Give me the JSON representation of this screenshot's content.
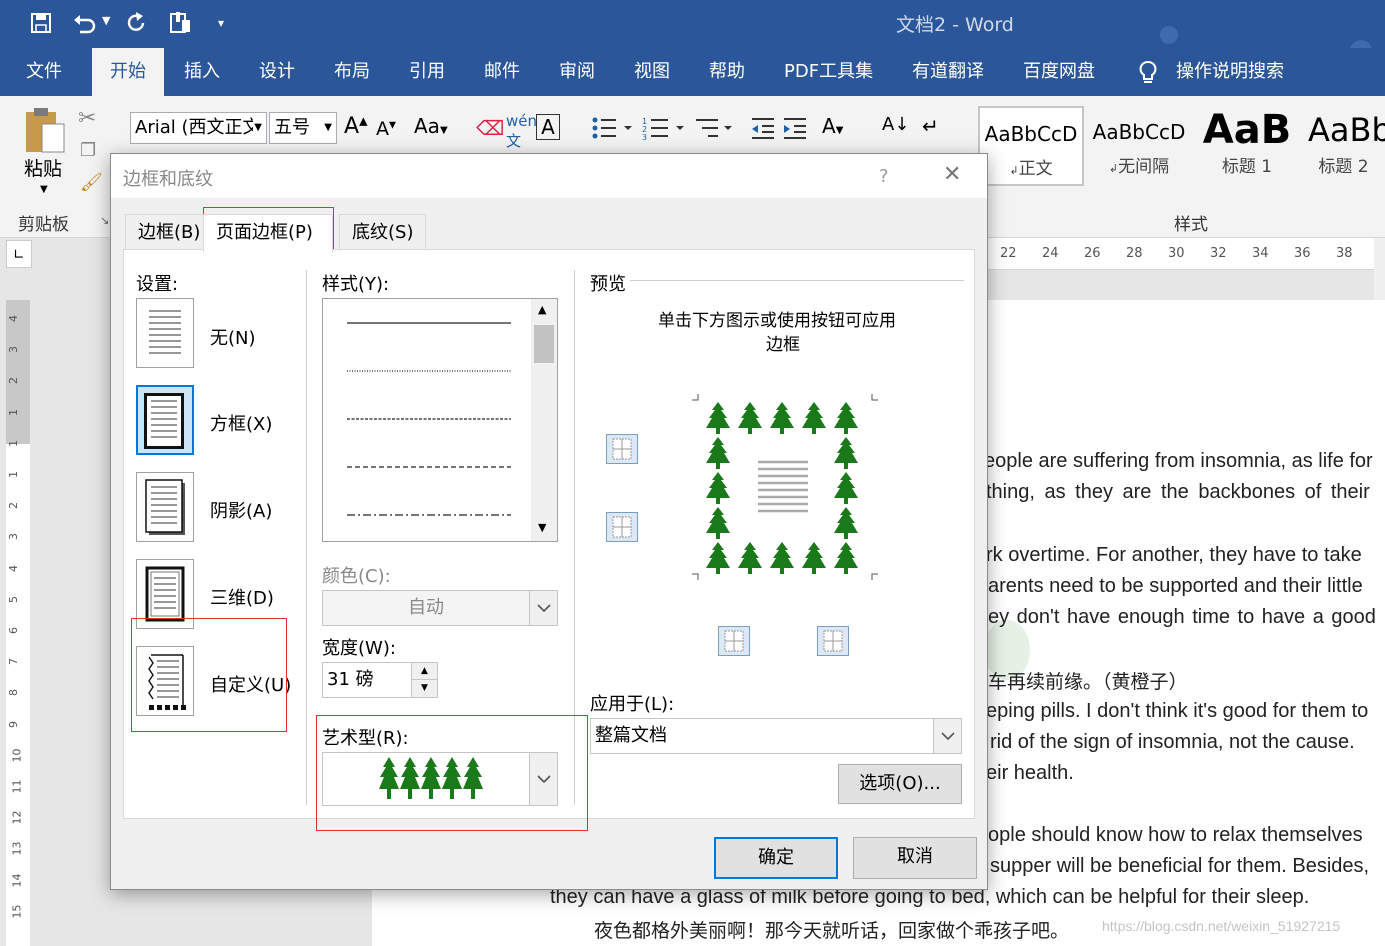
{
  "window": {
    "title": "文档2  -  Word"
  },
  "menu": {
    "items": [
      "文件",
      "开始",
      "插入",
      "设计",
      "布局",
      "引用",
      "邮件",
      "审阅",
      "视图",
      "帮助",
      "PDF工具集",
      "有道翻译",
      "百度网盘"
    ],
    "active": "开始",
    "search": "操作说明搜索"
  },
  "ribbon": {
    "paste": "粘贴",
    "clipboard_group": "剪贴板",
    "font_name": "Arial (西文正文",
    "font_size": "五号",
    "styles_group": "样式",
    "styles": [
      {
        "sample": "AaBbCcD",
        "name": "正文"
      },
      {
        "sample": "AaBbCcD",
        "name": "无间隔"
      },
      {
        "sample": "AaB",
        "name": "标题 1"
      },
      {
        "sample": "AaBb",
        "name": "标题 2"
      }
    ]
  },
  "ruler": {
    "top_ticks": [
      "22",
      "24",
      "26",
      "28",
      "30",
      "32",
      "34",
      "36",
      "38"
    ],
    "left_ticks": [
      "4",
      "3",
      "2",
      "1",
      "1",
      "1",
      "2",
      "3",
      "4",
      "5",
      "6",
      "7",
      "8",
      "9",
      "10",
      "11",
      "12",
      "13",
      "14",
      "15"
    ]
  },
  "document": {
    "lines": [
      "eople are suffering from insomnia, as life for",
      "thing, as they are the backbones of their",
      "rk overtime. For another, they have to take",
      "arents need to be supported and their little",
      "ey don't have enough time to have a good",
      "车再续前缘。（黄橙子）",
      "eping pills. I don't think it's good for them to",
      "rid of the sign of insomnia, not the cause.",
      "eir health.",
      "ople should know how to relax themselves",
      "supper will be beneficial for them. Besides,",
      "they can have a glass of milk before going to bed, which can be helpful for their sleep.",
      "夜色都格外美丽啊！那今天就听话，回家做个乖孩子吧。"
    ],
    "watermark": "https://blog.csdn.net/weixin_51927215"
  },
  "dialog": {
    "title": "边框和底纹",
    "help": "?",
    "tabs": [
      "边框(B)",
      "页面边框(P)",
      "底纹(S)"
    ],
    "active_tab": "页面边框(P)",
    "settings_label": "设置:",
    "settings": [
      "无(N)",
      "方框(X)",
      "阴影(A)",
      "三维(D)",
      "自定义(U)"
    ],
    "style_label": "样式(Y):",
    "color_label": "颜色(C):",
    "color_value": "自动",
    "width_label": "宽度(W):",
    "width_value": "31 磅",
    "art_label": "艺术型(R):",
    "preview_label": "预览",
    "preview_hint": [
      "单击下方图示或使用按钮可应用",
      "边框"
    ],
    "apply_label": "应用于(L):",
    "apply_value": "整篇文档",
    "options_button": "选项(O)...",
    "ok_button": "确定",
    "cancel_button": "取消"
  },
  "colors": {
    "brand": "#2b579a",
    "tree": "#1a7a1a",
    "highlight": "#e03030",
    "accent_border": "#0078d7"
  }
}
